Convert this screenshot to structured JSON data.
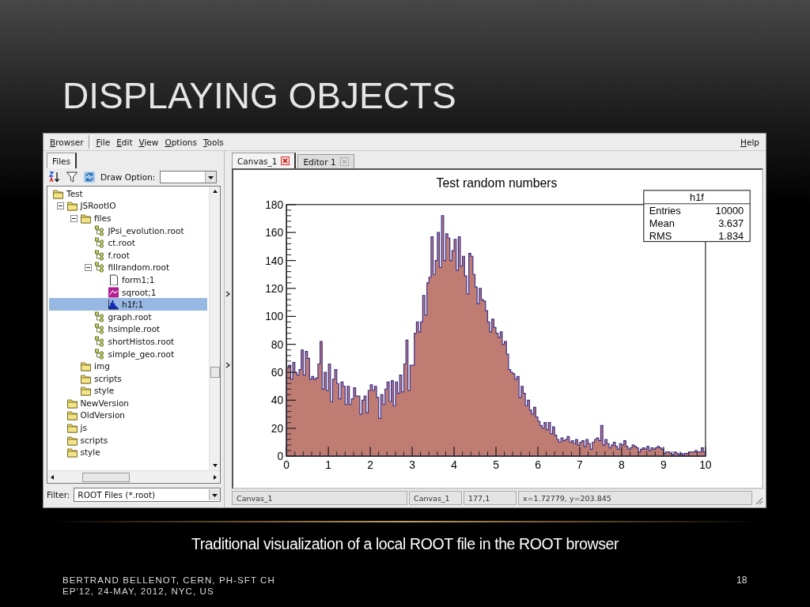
{
  "slide": {
    "title": "DISPLAYING OBJECTS",
    "caption": "Traditional visualization of a local ROOT file in the ROOT browser",
    "footer": [
      "BERTRAND BELLENOT, CERN, PH-SFT CH",
      "EP'12, 24-MAY, 2012, NYC, US"
    ],
    "page_number": "18"
  },
  "window": {
    "menu_left": "Browser",
    "menu": [
      "File",
      "Edit",
      "View",
      "Options",
      "Tools"
    ],
    "menu_right": "Help",
    "left_panel": {
      "tabs": [
        {
          "label": "Files",
          "selected": true
        }
      ],
      "draw_option_label": "Draw Option:",
      "tree": [
        {
          "label": "Test",
          "kind": "folder",
          "selected": false,
          "children": [
            {
              "label": "JSRootIO",
              "kind": "folder",
              "expanded": true,
              "selected": false,
              "children": [
                {
                  "label": "files",
                  "kind": "folder",
                  "expanded": true,
                  "selected": false,
                  "children": [
                    {
                      "label": "JPsi_evolution.root",
                      "kind": "rootfile",
                      "selected": false
                    },
                    {
                      "label": "ct.root",
                      "kind": "rootfile",
                      "selected": false
                    },
                    {
                      "label": "f.root",
                      "kind": "rootfile",
                      "selected": false
                    },
                    {
                      "label": "fillrandom.root",
                      "kind": "rootfile",
                      "expanded": true,
                      "selected": false,
                      "children": [
                        {
                          "label": "form1;1",
                          "kind": "page",
                          "selected": false
                        },
                        {
                          "label": "sqroot;1",
                          "kind": "graph",
                          "selected": false
                        },
                        {
                          "label": "h1f;1",
                          "kind": "histogram",
                          "selected": true
                        }
                      ]
                    },
                    {
                      "label": "graph.root",
                      "kind": "rootfile",
                      "selected": false
                    },
                    {
                      "label": "hsimple.root",
                      "kind": "rootfile",
                      "selected": false
                    },
                    {
                      "label": "shortHistos.root",
                      "kind": "rootfile",
                      "selected": false
                    },
                    {
                      "label": "simple_geo.root",
                      "kind": "rootfile",
                      "selected": false
                    }
                  ]
                },
                {
                  "label": "img",
                  "kind": "folder",
                  "selected": false
                },
                {
                  "label": "scripts",
                  "kind": "folder",
                  "selected": false
                },
                {
                  "label": "style",
                  "kind": "folder",
                  "selected": false
                }
              ]
            },
            {
              "label": "NewVersion",
              "kind": "folder",
              "selected": false
            },
            {
              "label": "OldVersion",
              "kind": "folder",
              "selected": false
            },
            {
              "label": "js",
              "kind": "folder",
              "selected": false
            },
            {
              "label": "scripts",
              "kind": "folder",
              "selected": false
            },
            {
              "label": "style",
              "kind": "folder",
              "selected": false
            }
          ]
        }
      ],
      "filter": {
        "label": "Filter:",
        "value": "ROOT Files (*.root)"
      }
    },
    "right_panel": {
      "tabs": [
        {
          "label": "Canvas_1",
          "selected": true
        },
        {
          "label": "Editor 1",
          "selected": false
        }
      ],
      "chart_data": {
        "type": "area",
        "title": "Test random numbers",
        "xlim": [
          0,
          10
        ],
        "x": [
          0,
          0.05,
          0.1,
          0.15,
          0.2,
          0.25,
          0.3,
          0.35,
          0.4,
          0.45,
          0.5,
          0.55,
          0.6,
          0.65,
          0.7,
          0.75,
          0.8,
          0.85,
          0.9,
          0.95,
          1,
          1.05,
          1.1,
          1.15,
          1.2,
          1.25,
          1.3,
          1.35,
          1.4,
          1.45,
          1.5,
          1.55,
          1.6,
          1.65,
          1.7,
          1.75,
          1.8,
          1.85,
          1.9,
          1.95,
          2,
          2.05,
          2.1,
          2.15,
          2.2,
          2.25,
          2.3,
          2.35,
          2.4,
          2.45,
          2.5,
          2.55,
          2.6,
          2.65,
          2.7,
          2.75,
          2.8,
          2.85,
          2.9,
          2.95,
          3,
          3.05,
          3.1,
          3.15,
          3.2,
          3.25,
          3.3,
          3.35,
          3.4,
          3.45,
          3.5,
          3.55,
          3.6,
          3.65,
          3.7,
          3.75,
          3.8,
          3.85,
          3.9,
          3.95,
          4,
          4.05,
          4.1,
          4.15,
          4.2,
          4.25,
          4.3,
          4.35,
          4.4,
          4.45,
          4.5,
          4.55,
          4.6,
          4.65,
          4.7,
          4.75,
          4.8,
          4.85,
          4.9,
          4.95,
          5,
          5.05,
          5.1,
          5.15,
          5.2,
          5.25,
          5.3,
          5.35,
          5.4,
          5.45,
          5.5,
          5.55,
          5.6,
          5.65,
          5.7,
          5.75,
          5.8,
          5.85,
          5.9,
          5.95,
          6,
          6.05,
          6.1,
          6.15,
          6.2,
          6.25,
          6.3,
          6.35,
          6.4,
          6.45,
          6.5,
          6.55,
          6.6,
          6.65,
          6.7,
          6.75,
          6.8,
          6.85,
          6.9,
          6.95,
          7,
          7.05,
          7.1,
          7.15,
          7.2,
          7.25,
          7.3,
          7.35,
          7.4,
          7.45,
          7.5,
          7.55,
          7.6,
          7.65,
          7.7,
          7.75,
          7.8,
          7.85,
          7.9,
          7.95,
          8,
          8.05,
          8.1,
          8.15,
          8.2,
          8.25,
          8.3,
          8.35,
          8.4,
          8.45,
          8.5,
          8.55,
          8.6,
          8.65,
          8.7,
          8.75,
          8.8,
          8.85,
          8.9,
          8.95,
          9,
          9.05,
          9.1,
          9.15,
          9.2,
          9.25,
          9.3,
          9.35,
          9.4,
          9.45,
          9.5,
          9.55,
          9.6,
          9.65,
          9.7,
          9.75,
          9.8,
          9.85,
          9.9,
          9.95
        ],
        "ylim": [
          0,
          180
        ],
        "xticks": [
          0,
          1,
          2,
          3,
          4,
          5,
          6,
          7,
          8,
          9,
          10
        ],
        "yticks": [
          0,
          20,
          40,
          60,
          80,
          100,
          120,
          140,
          160,
          180
        ],
        "values": [
          63,
          65,
          55,
          67,
          60,
          58,
          62,
          76,
          58,
          75,
          70,
          55,
          57,
          55,
          56,
          66,
          82,
          48,
          60,
          47,
          66,
          39,
          55,
          62,
          52,
          41,
          53,
          50,
          37,
          50,
          37,
          41,
          49,
          43,
          43,
          30,
          40,
          43,
          31,
          47,
          51,
          47,
          50,
          42,
          27,
          44,
          37,
          48,
          53,
          39,
          54,
          36,
          53,
          45,
          58,
          46,
          66,
          83,
          47,
          65,
          65,
          88,
          96,
          89,
          96,
          115,
          101,
          124,
          128,
          157,
          130,
          140,
          160,
          135,
          172,
          140,
          159,
          156,
          140,
          147,
          155,
          133,
          157,
          136,
          143,
          129,
          116,
          145,
          143,
          130,
          121,
          109,
          120,
          112,
          111,
          104,
          96,
          89,
          98,
          92,
          88,
          85,
          89,
          80,
          82,
          73,
          62,
          60,
          59,
          55,
          57,
          42,
          50,
          45,
          36,
          40,
          33,
          30,
          35,
          28,
          25,
          22,
          20,
          24,
          19,
          24,
          16,
          21,
          15,
          12,
          10,
          13,
          11,
          12,
          14,
          10,
          11,
          9,
          12,
          8,
          10,
          11,
          7,
          12,
          9,
          5,
          10,
          12,
          13,
          11,
          22,
          8,
          12,
          9,
          6,
          8,
          10,
          7,
          5,
          9,
          8,
          11,
          7,
          5,
          6,
          8,
          7,
          6,
          3,
          5,
          6,
          5,
          7,
          4,
          6,
          5,
          6,
          7,
          6,
          5,
          2,
          3,
          3,
          2,
          1,
          3,
          2,
          1,
          2,
          1,
          2,
          2,
          3,
          3,
          3,
          4,
          3,
          3,
          6,
          3
        ]
      },
      "stats_box": {
        "title": "h1f",
        "rows": [
          {
            "name": "Entries",
            "value": "10000"
          },
          {
            "name": "Mean",
            "value": "3.637"
          },
          {
            "name": "RMS",
            "value": "1.834"
          }
        ]
      },
      "status_bar": [
        "Canvas_1",
        "Canvas_1",
        "177,1",
        "x=1.72779, y=203.845"
      ]
    }
  }
}
